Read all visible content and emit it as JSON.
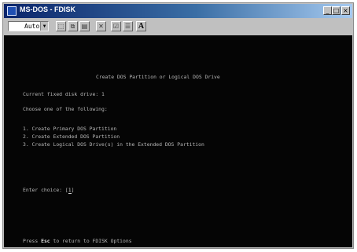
{
  "window": {
    "title": "MS-DOS - FDISK",
    "minimize_glyph": "_",
    "maximize_glyph": "□",
    "close_glyph": "×"
  },
  "toolbar": {
    "font_size": "Auto",
    "font_button": "A",
    "icons": [
      "mark-icon",
      "copy-icon",
      "paste-icon",
      "fullscreen-icon",
      "properties-icon",
      "background-icon",
      "font-icon"
    ]
  },
  "console": {
    "heading": "Create DOS Partition or Logical DOS Drive",
    "current_drive_label": "Current fixed disk drive:",
    "current_drive_value": "1",
    "prompt": "Choose one of the following:",
    "options": [
      "1. Create Primary DOS Partition",
      "2. Create Extended DOS Partition",
      "3. Create Logical DOS Drive(s) in the Extended DOS Partition"
    ],
    "choice_label": "Enter choice:",
    "choice_value": "1",
    "footer_prefix": "Press",
    "footer_key": "Esc",
    "footer_suffix": "to return to FDISK Options"
  },
  "colors": {
    "console_bg": "#050505",
    "console_text": "#b8b8b8",
    "titlebar": "#0a246a"
  }
}
